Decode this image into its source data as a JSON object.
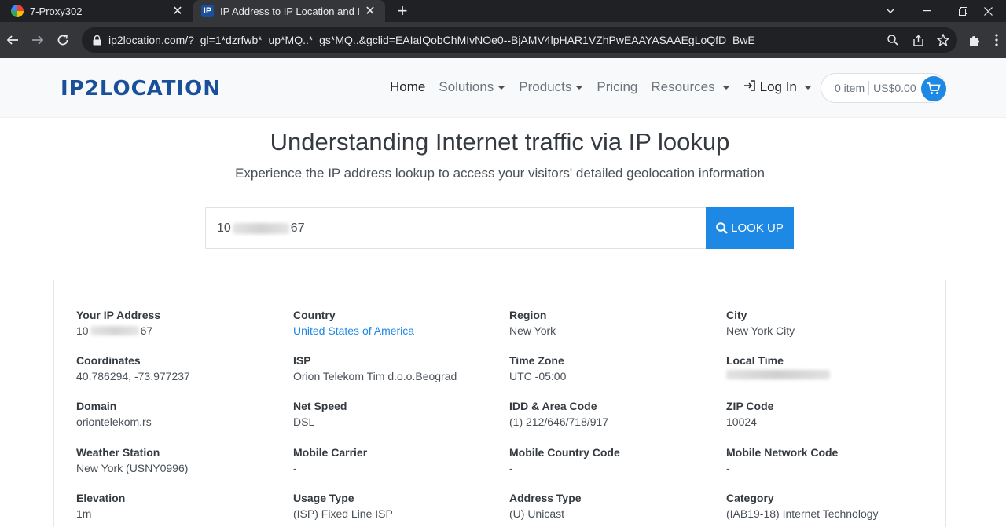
{
  "browser": {
    "tabs": [
      {
        "title": "7-Proxy302",
        "active": false,
        "icon": "multicolor-app-icon"
      },
      {
        "title": "IP Address to IP Location and I",
        "active": true,
        "icon": "ip2location-favicon",
        "icon_text": "IP"
      }
    ],
    "new_tab": "+",
    "url": "ip2location.com/?_gl=1*dzrfwb*_up*MQ..*_gs*MQ..&gclid=EAIaIQobChMIvNOe0--BjAMV4lpHAR1VZhPwEAAYASAAEgLoQfD_BwE"
  },
  "site": {
    "logo": "IP2LOCATION",
    "nav": {
      "home": "Home",
      "solutions": "Solutions",
      "products": "Products",
      "pricing": "Pricing",
      "resources": "Resources",
      "login": "Log In"
    },
    "cart": {
      "items": "0 item",
      "total": "US$0.00"
    }
  },
  "hero": {
    "title": "Understanding Internet traffic via IP lookup",
    "subtitle": "Experience the IP address lookup to access your visitors' detailed geolocation information"
  },
  "search": {
    "ip_prefix": "10",
    "ip_suffix": "67",
    "button": "LOOK UP"
  },
  "result": {
    "your_ip": {
      "label": "Your IP Address",
      "prefix": "10",
      "suffix": "67"
    },
    "country": {
      "label": "Country",
      "value": "United States of America"
    },
    "region": {
      "label": "Region",
      "value": "New York"
    },
    "city": {
      "label": "City",
      "value": "New York City"
    },
    "coordinates": {
      "label": "Coordinates",
      "value": "40.786294, -73.977237"
    },
    "isp": {
      "label": "ISP",
      "value": "Orion Telekom Tim d.o.o.Beograd"
    },
    "time_zone": {
      "label": "Time Zone",
      "value": "UTC -05:00"
    },
    "local_time": {
      "label": "Local Time"
    },
    "domain": {
      "label": "Domain",
      "value": "oriontelekom.rs"
    },
    "net_speed": {
      "label": "Net Speed",
      "value": "DSL"
    },
    "idd_area": {
      "label": "IDD & Area Code",
      "value": "(1) 212/646/718/917"
    },
    "zip": {
      "label": "ZIP Code",
      "value": "10024"
    },
    "weather": {
      "label": "Weather Station",
      "value": "New York (USNY0996)"
    },
    "mobile_carrier": {
      "label": "Mobile Carrier",
      "value": "-"
    },
    "mobile_country_code": {
      "label": "Mobile Country Code",
      "value": "-"
    },
    "mobile_network_code": {
      "label": "Mobile Network Code",
      "value": "-"
    },
    "elevation": {
      "label": "Elevation",
      "value": "1m"
    },
    "usage_type": {
      "label": "Usage Type",
      "value": "(ISP) Fixed Line ISP"
    },
    "address_type": {
      "label": "Address Type",
      "value": "(U) Unicast"
    },
    "category": {
      "label": "Category",
      "value": "(IAB19-18) Internet Technology"
    }
  },
  "colors": {
    "accent": "#1e88e5",
    "logo": "#1a4f9c",
    "chrome_dark": "#202124",
    "chrome_mid": "#35363a"
  }
}
